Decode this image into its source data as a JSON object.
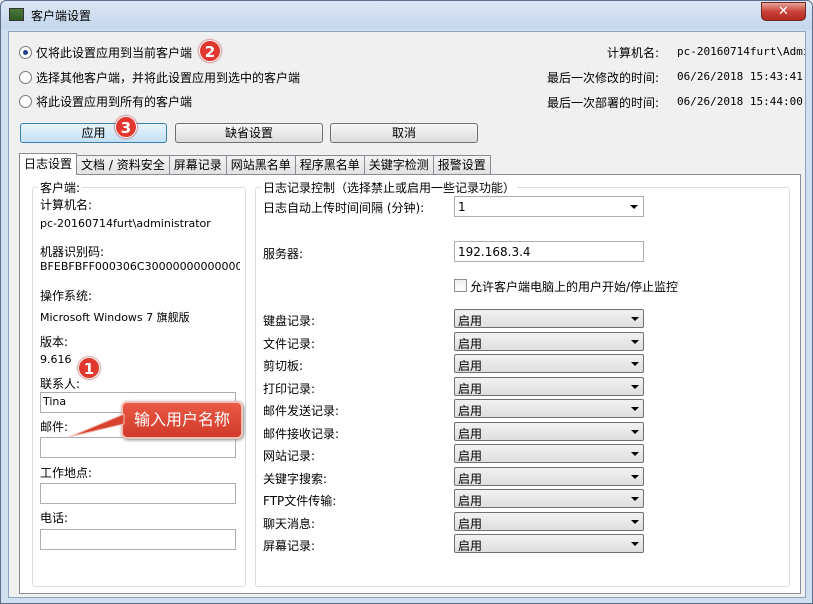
{
  "window": {
    "title": "客户端设置",
    "close_glyph": "✕"
  },
  "scope": {
    "options": [
      "仅将此设置应用到当前客户端",
      "选择其他客户端，并将此设置应用到选中的客户端",
      "将此设置应用到所有的客户端"
    ],
    "selected_index": 0
  },
  "info": {
    "computer_label": "计算机名:",
    "computer_value": "pc-20160714furt\\Admini",
    "modified_label": "最后一次修改的时间:",
    "modified_value": "06/26/2018 15:43:41",
    "deployed_label": "最后一次部署的时间:",
    "deployed_value": "06/26/2018 15:44:00"
  },
  "buttons": {
    "apply": "应用",
    "default": "缺省设置",
    "cancel": "取消"
  },
  "badges": {
    "b1": "1",
    "b2": "2",
    "b3": "3"
  },
  "tabs": [
    "日志设置",
    "文档 / 资料安全",
    "屏幕记录",
    "网站黑名单",
    "程序黑名单",
    "关键字检测",
    "报警设置"
  ],
  "client": {
    "group_title": "客户端:",
    "computer_label": "计算机名:",
    "computer_value": "pc-20160714furt\\administrator",
    "machine_label": "机器识别码:",
    "machine_value": "BFEBFBFF000306C30000000000000000",
    "os_label": "操作系统:",
    "os_value": "Microsoft Windows 7 旗舰版",
    "version_label": "版本:",
    "version_value": "9.616",
    "contact_label": "联系人:",
    "contact_value": "Tina",
    "mail_label": "邮件:",
    "workplace_label": "工作地点:",
    "phone_label": "电话:"
  },
  "callout": "输入用户名称",
  "log_control": {
    "group_title": "日志记录控制（选择禁止或启用一些记录功能）",
    "upload_label": "日志自动上传时间间隔 (分钟):",
    "upload_value": "1",
    "server_label": "服务器:",
    "server_value": "192.168.3.4",
    "allow_label": "允许客户端电脑上的用户开始/停止监控",
    "rows": [
      {
        "label": "键盘记录:",
        "value": "启用"
      },
      {
        "label": "文件记录:",
        "value": "启用"
      },
      {
        "label": "剪切板:",
        "value": "启用"
      },
      {
        "label": "打印记录:",
        "value": "启用"
      },
      {
        "label": "邮件发送记录:",
        "value": "启用"
      },
      {
        "label": "邮件接收记录:",
        "value": "启用"
      },
      {
        "label": "网站记录:",
        "value": "启用"
      },
      {
        "label": "关键字搜索:",
        "value": "启用"
      },
      {
        "label": "FTP文件传输:",
        "value": "启用"
      },
      {
        "label": "聊天消息:",
        "value": "启用"
      },
      {
        "label": "屏幕记录:",
        "value": "启用"
      }
    ]
  }
}
